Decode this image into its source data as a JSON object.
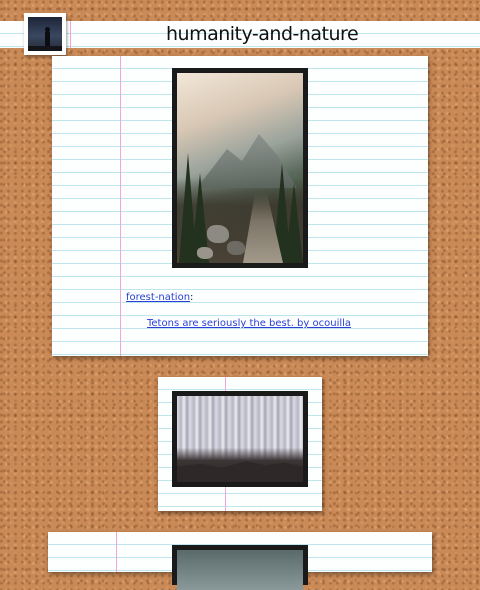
{
  "header": {
    "title": "humanity-and-nature"
  },
  "post1": {
    "source_blog": "forest-nation",
    "source_suffix": ":",
    "caption_link": "Tetons are seriously the best. by ocouilla"
  }
}
